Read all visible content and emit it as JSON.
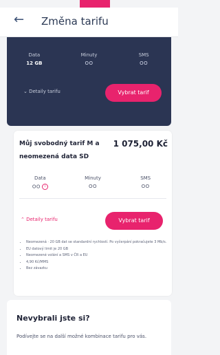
{
  "header": {
    "back_icon": "arrow-left-icon",
    "title": "Změna tarifu"
  },
  "colors": {
    "accent": "#e8236d",
    "navy": "#2b3553",
    "background": "#f3f4f6"
  },
  "dark_plan": {
    "stats": [
      {
        "label": "Data",
        "value": "12 GB"
      },
      {
        "label": "Minuty",
        "value": "OO"
      },
      {
        "label": "SMS",
        "value": "OO"
      }
    ],
    "details_label": "Detaily tarifu",
    "select_label": "Vybrat tarif"
  },
  "current_plan": {
    "name": "Můj svobodný tarif M a neomezená data SD",
    "price": "1 075,00 Kč",
    "stats": [
      {
        "label": "Data",
        "value": "OO"
      },
      {
        "label": "Minuty",
        "value": "OO"
      },
      {
        "label": "SMS",
        "value": "OO"
      }
    ],
    "info_icon": "info-circle-icon",
    "details_label": "Detaily tarifu",
    "select_label": "Vybrat tarif",
    "features": [
      "Neomezená · 20 GB dat se standardní rychlostí. Po vyčerpání pokračujete 3 Mb/s.",
      "EU datový limit je 20 GB",
      "Neomezené volání a SMS v ČR a EU",
      "4,90 Kč/MMS",
      "Bez závazku"
    ]
  },
  "promo": {
    "headline": "Nevybrali jste si?",
    "body": "Podívejte se na další možné kombinace tarifu pro vás."
  }
}
